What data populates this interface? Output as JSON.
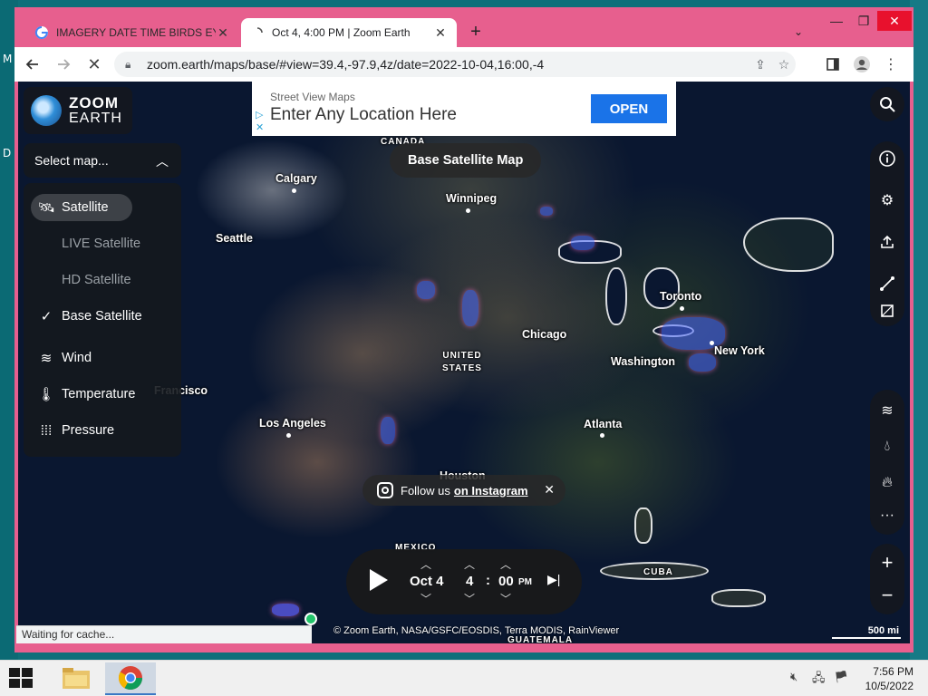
{
  "window": {
    "tabs": [
      {
        "title": "IMAGERY DATE TIME BIRDS EYE",
        "active": false
      },
      {
        "title": "Oct 4, 4:00 PM | Zoom Earth",
        "active": true
      }
    ],
    "url": "zoom.earth/maps/base/#view=39.4,-97.9,4z/date=2022-10-04,16:00,-4",
    "status_text": "Waiting for cache..."
  },
  "logo": {
    "line1": "ZOOM",
    "line2": "EARTH"
  },
  "select_map": {
    "label": "Select map..."
  },
  "layer_menu": {
    "items": [
      {
        "label": "Satellite",
        "icon": "satellite-icon",
        "state": "selected"
      },
      {
        "label": "LIVE Satellite",
        "icon": "",
        "state": "disabled"
      },
      {
        "label": "HD Satellite",
        "icon": "",
        "state": "disabled"
      },
      {
        "label": "Base Satellite",
        "icon": "checkmark-icon",
        "state": "checked"
      },
      {
        "label": "Wind",
        "icon": "wind-icon",
        "state": "normal"
      },
      {
        "label": "Temperature",
        "icon": "thermometer-icon",
        "state": "normal"
      },
      {
        "label": "Pressure",
        "icon": "pressure-icon",
        "state": "normal"
      }
    ]
  },
  "map_title": "Base Satellite Map",
  "ad": {
    "small": "Street View Maps",
    "big": "Enter Any Location Here",
    "button": "OPEN"
  },
  "map_labels": {
    "canada": "CANADA",
    "usa_line1": "UNITED",
    "usa_line2": "STATES",
    "mexico": "MEXICO",
    "cuba": "CUBA",
    "guatemala": "GUATEMALA",
    "calgary": "Calgary",
    "winnipeg": "Winnipeg",
    "seattle": "Seattle",
    "toronto": "Toronto",
    "chicago": "Chicago",
    "new_york": "New York",
    "washington": "Washington",
    "san_francisco": "Francisco",
    "los_angeles": "Los Angeles",
    "atlanta": "Atlanta",
    "houston": "Houston"
  },
  "instagram": {
    "prefix": "Follow us",
    "link": "on Instagram"
  },
  "timebar": {
    "date": "Oct 4",
    "hour": "4",
    "minute": "00",
    "ampm": "PM"
  },
  "credits": "© Zoom Earth, NASA/GSFC/EOSDIS, Terra MODIS, RainViewer",
  "scale": "500 mi",
  "taskbar": {
    "time": "7:56 PM",
    "date": "10/5/2022"
  },
  "desktop_letters": [
    "M",
    "D"
  ]
}
